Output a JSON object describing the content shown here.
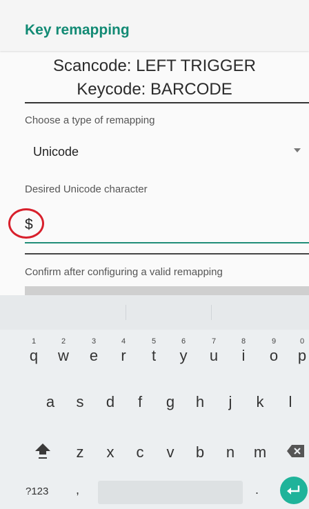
{
  "app_bar": {
    "title": "Key remapping"
  },
  "codes": {
    "scancode": "Scancode: LEFT TRIGGER",
    "keycode": "Keycode: BARCODE"
  },
  "remap_type": {
    "label": "Choose a type of remapping",
    "selected": "Unicode"
  },
  "unicode_field": {
    "label": "Desired Unicode character",
    "value": "$"
  },
  "confirm_text": "Confirm after configuring a valid remapping",
  "keyboard": {
    "row1": [
      "q",
      "w",
      "e",
      "r",
      "t",
      "y",
      "u",
      "i",
      "o",
      "p"
    ],
    "row1_numbers": [
      "1",
      "2",
      "3",
      "4",
      "5",
      "6",
      "7",
      "8",
      "9",
      "0"
    ],
    "row2": [
      "a",
      "s",
      "d",
      "f",
      "g",
      "h",
      "j",
      "k",
      "l"
    ],
    "row3": [
      "z",
      "x",
      "c",
      "v",
      "b",
      "n",
      "m"
    ],
    "symbols_key": "?123",
    "comma": ",",
    "period": "."
  },
  "colors": {
    "accent": "#128a74",
    "highlight_circle": "#d8202c",
    "enter": "#1fb39a"
  },
  "icons": {
    "dropdown": "chevron-down-icon",
    "shift": "shift-icon",
    "backspace": "backspace-icon",
    "enter": "enter-icon"
  }
}
